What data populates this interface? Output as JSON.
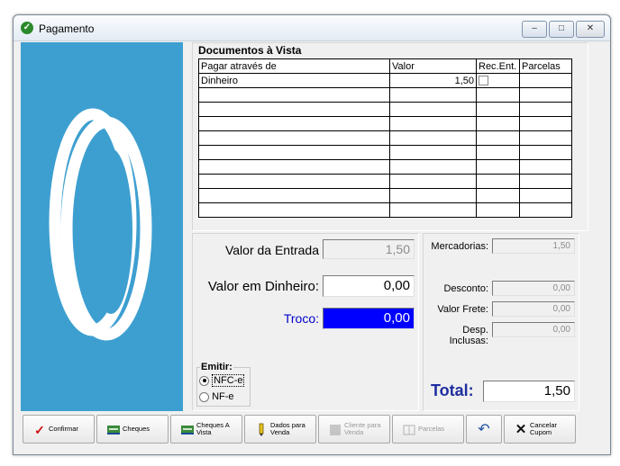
{
  "window": {
    "title": "Pagamento"
  },
  "titlebar": {
    "minimize": "–",
    "maximize": "□",
    "close": "✕"
  },
  "documents": {
    "title": "Documentos à Vista",
    "columns": [
      "Pagar através de",
      "Valor",
      "Rec.Ent.",
      "Parcelas"
    ],
    "rows": [
      {
        "method": "Dinheiro",
        "value": "1,50",
        "rec_ent": false,
        "parcelas": ""
      }
    ],
    "empty_rows": 9
  },
  "entry": {
    "valor_entrada_label": "Valor da Entrada",
    "valor_entrada_value": "1,50",
    "valor_dinheiro_label": "Valor em Dinheiro:",
    "valor_dinheiro_value": "0,00",
    "troco_label": "Troco:",
    "troco_value": "0,00"
  },
  "emitir": {
    "title": "Emitir:",
    "options": [
      {
        "label": "NFC-e",
        "selected": true
      },
      {
        "label": "NF-e",
        "selected": false
      }
    ]
  },
  "summary": {
    "mercadorias_label": "Mercadorias:",
    "mercadorias_value": "1,50",
    "desconto_label": "Desconto:",
    "desconto_value": "0,00",
    "frete_label": "Valor Frete:",
    "frete_value": "0,00",
    "desp_label": "Desp. Inclusas:",
    "desp_value": "0,00",
    "total_label": "Total:",
    "total_value": "1,50"
  },
  "buttons": {
    "confirmar": "Confirmar",
    "cheques": "Cheques",
    "cheques_vista": "Cheques A Vista",
    "dados_venda": "Dados para Venda",
    "cliente_venda": "Cliente para Venda",
    "parcelas": "Parcelas",
    "cancelar_cupom": "Cancelar Cupom"
  },
  "colors": {
    "logo_bg": "#3d9fd0",
    "troco_bg": "#0000ff",
    "total_label": "#1f2fa0"
  }
}
